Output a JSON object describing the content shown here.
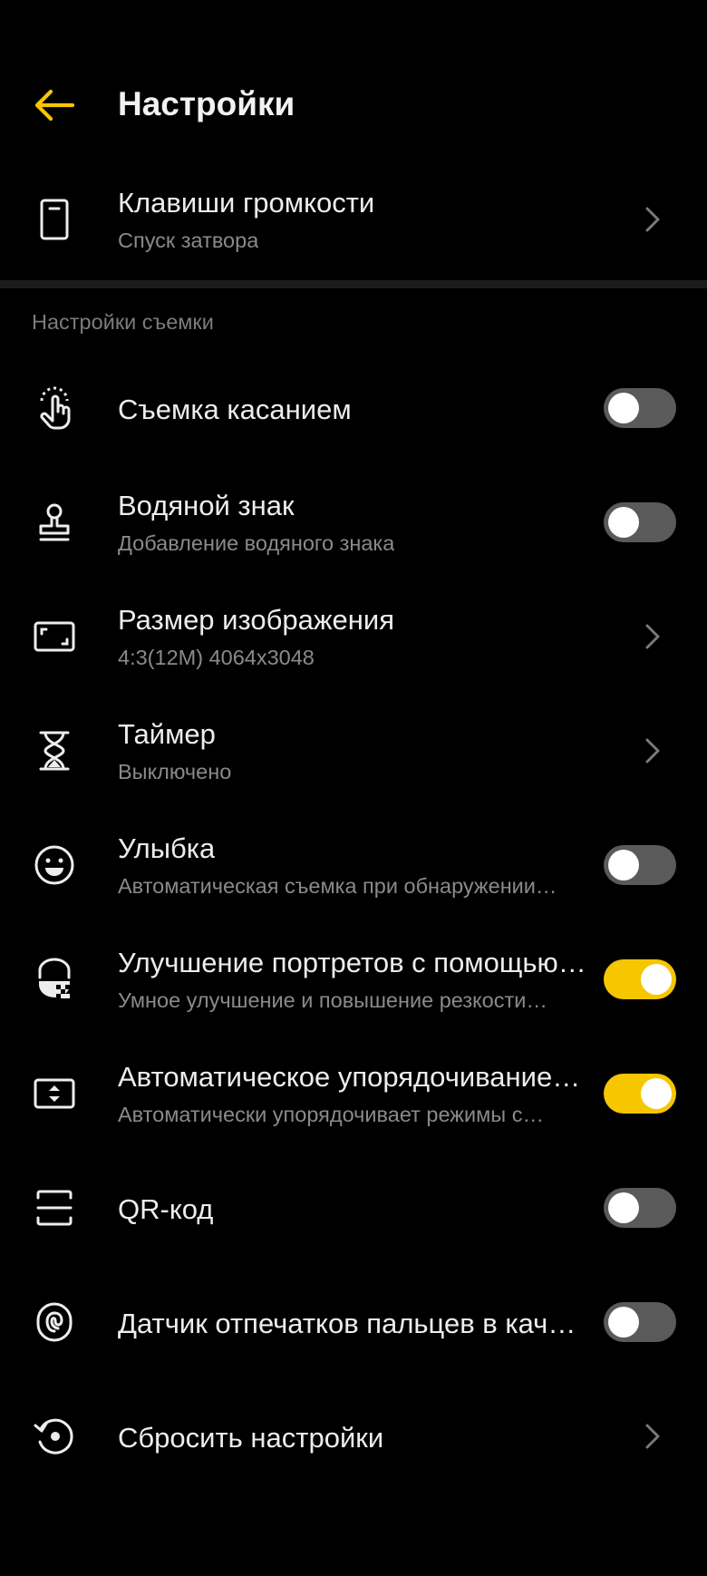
{
  "header": {
    "title": "Настройки",
    "accent_color": "#F6C600"
  },
  "volume_keys": {
    "title": "Клавиши громкости",
    "subtitle": "Спуск затвора",
    "icon": "phone-icon"
  },
  "section": {
    "label": "Настройки съемки"
  },
  "settings": [
    {
      "title": "Съемка касанием",
      "subtitle": "",
      "control": "toggle",
      "on": false,
      "icon": "touch-icon"
    },
    {
      "title": "Водяной знак",
      "subtitle": "Добавление водяного знака",
      "control": "toggle",
      "on": false,
      "icon": "stamp-icon"
    },
    {
      "title": "Размер изображения",
      "subtitle": "4:3(12M) 4064x3048",
      "control": "chevron",
      "icon": "frame-icon"
    },
    {
      "title": "Таймер",
      "subtitle": "Выключено",
      "control": "chevron",
      "icon": "hourglass-icon"
    },
    {
      "title": "Улыбка",
      "subtitle": "Автоматическая съемка при обнаружении…",
      "control": "toggle",
      "on": false,
      "icon": "smile-icon"
    },
    {
      "title": "Улучшение портретов с помощью…",
      "subtitle": "Умное улучшение и повышение резкости…",
      "control": "toggle",
      "on": true,
      "icon": "portrait-enhance-icon"
    },
    {
      "title": "Автоматическое упорядочивание…",
      "subtitle": "Автоматически упорядочивает режимы с…",
      "control": "toggle",
      "on": true,
      "icon": "sort-icon"
    },
    {
      "title": "QR-код",
      "subtitle": "",
      "control": "toggle",
      "on": false,
      "icon": "qr-scan-icon"
    },
    {
      "title": "Датчик отпечатков пальцев в кач…",
      "subtitle": "",
      "control": "toggle",
      "on": false,
      "icon": "fingerprint-icon"
    },
    {
      "title": "Сбросить настройки",
      "subtitle": "",
      "control": "chevron",
      "icon": "reset-icon"
    }
  ]
}
